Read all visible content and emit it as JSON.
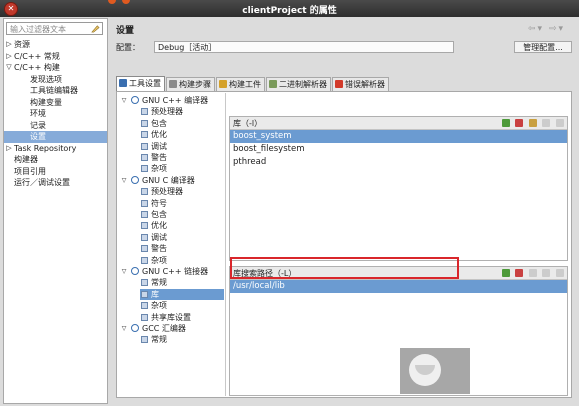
{
  "window": {
    "title": "clientProject 的属性"
  },
  "filter": {
    "placeholder": "输入过滤器文本"
  },
  "nav": {
    "items": [
      {
        "label": "资源",
        "level": 0,
        "expander": "▷",
        "selected": false
      },
      {
        "label": "C/C++ 常规",
        "level": 0,
        "expander": "▷",
        "selected": false
      },
      {
        "label": "C/C++ 构建",
        "level": 0,
        "expander": "▽",
        "selected": false
      },
      {
        "label": "发现选项",
        "level": 1,
        "expander": "",
        "selected": false
      },
      {
        "label": "工具链编辑器",
        "level": 1,
        "expander": "",
        "selected": false
      },
      {
        "label": "构建变量",
        "level": 1,
        "expander": "",
        "selected": false
      },
      {
        "label": "环境",
        "level": 1,
        "expander": "",
        "selected": false
      },
      {
        "label": "记录",
        "level": 1,
        "expander": "",
        "selected": false
      },
      {
        "label": "设置",
        "level": 1,
        "expander": "",
        "selected": true
      },
      {
        "label": "Task Repository",
        "level": 0,
        "expander": "▷",
        "selected": false
      },
      {
        "label": "构建器",
        "level": 0,
        "expander": "",
        "selected": false
      },
      {
        "label": "项目引用",
        "level": 0,
        "expander": "",
        "selected": false
      },
      {
        "label": "运行／调试设置",
        "level": 0,
        "expander": "",
        "selected": false
      }
    ]
  },
  "header": {
    "title": "设置",
    "back": "⇦▾",
    "forward": "⇨▾"
  },
  "config": {
    "label": "配置：",
    "value": "Debug［活动］",
    "manage_label": "管理配置..."
  },
  "tabs": [
    {
      "label": "工具设置",
      "active": true,
      "icon_color": "#3a6fb0"
    },
    {
      "label": "构建步骤",
      "active": false,
      "icon_color": "#8a8a8a"
    },
    {
      "label": "构建工件",
      "active": false,
      "icon_color": "#d4a12a"
    },
    {
      "label": "二进制解析器",
      "active": false,
      "icon_color": "#7a9a5a"
    },
    {
      "label": "错误解析器",
      "active": false,
      "icon_color": "#d23a2a"
    }
  ],
  "tool_tree": [
    {
      "label": "GNU C++ 编译器",
      "level": 0,
      "type": "group",
      "selected": false
    },
    {
      "label": "预处理器",
      "level": 1,
      "type": "leaf",
      "selected": false
    },
    {
      "label": "包含",
      "level": 1,
      "type": "leaf",
      "selected": false
    },
    {
      "label": "优化",
      "level": 1,
      "type": "leaf",
      "selected": false
    },
    {
      "label": "调试",
      "level": 1,
      "type": "leaf",
      "selected": false
    },
    {
      "label": "警告",
      "level": 1,
      "type": "leaf",
      "selected": false
    },
    {
      "label": "杂项",
      "level": 1,
      "type": "leaf",
      "selected": false
    },
    {
      "label": "GNU C 编译器",
      "level": 0,
      "type": "group",
      "selected": false
    },
    {
      "label": "预处理器",
      "level": 1,
      "type": "leaf",
      "selected": false
    },
    {
      "label": "符号",
      "level": 1,
      "type": "leaf",
      "selected": false
    },
    {
      "label": "包含",
      "level": 1,
      "type": "leaf",
      "selected": false
    },
    {
      "label": "优化",
      "level": 1,
      "type": "leaf",
      "selected": false
    },
    {
      "label": "调试",
      "level": 1,
      "type": "leaf",
      "selected": false
    },
    {
      "label": "警告",
      "level": 1,
      "type": "leaf",
      "selected": false
    },
    {
      "label": "杂项",
      "level": 1,
      "type": "leaf",
      "selected": false
    },
    {
      "label": "GNU C++ 链接器",
      "level": 0,
      "type": "group",
      "selected": false
    },
    {
      "label": "常规",
      "level": 1,
      "type": "leaf",
      "selected": false
    },
    {
      "label": "库",
      "level": 1,
      "type": "leaf",
      "selected": true
    },
    {
      "label": "杂项",
      "level": 1,
      "type": "leaf",
      "selected": false
    },
    {
      "label": "共享库设置",
      "level": 1,
      "type": "leaf",
      "selected": false
    },
    {
      "label": "GCC 汇编器",
      "level": 0,
      "type": "group",
      "selected": false
    },
    {
      "label": "常规",
      "level": 1,
      "type": "leaf",
      "selected": false
    }
  ],
  "libraries": {
    "header": "库（-l）",
    "items": [
      "boost_system",
      "boost_filesystem",
      "pthread"
    ],
    "selected_index": 0
  },
  "lib_paths": {
    "header": "库搜索路径（-L）",
    "items": [
      "/usr/local/lib"
    ],
    "selected_index": 0
  },
  "colors": {
    "selection": "#6b9bd1",
    "highlight_box": "#d9262b"
  }
}
